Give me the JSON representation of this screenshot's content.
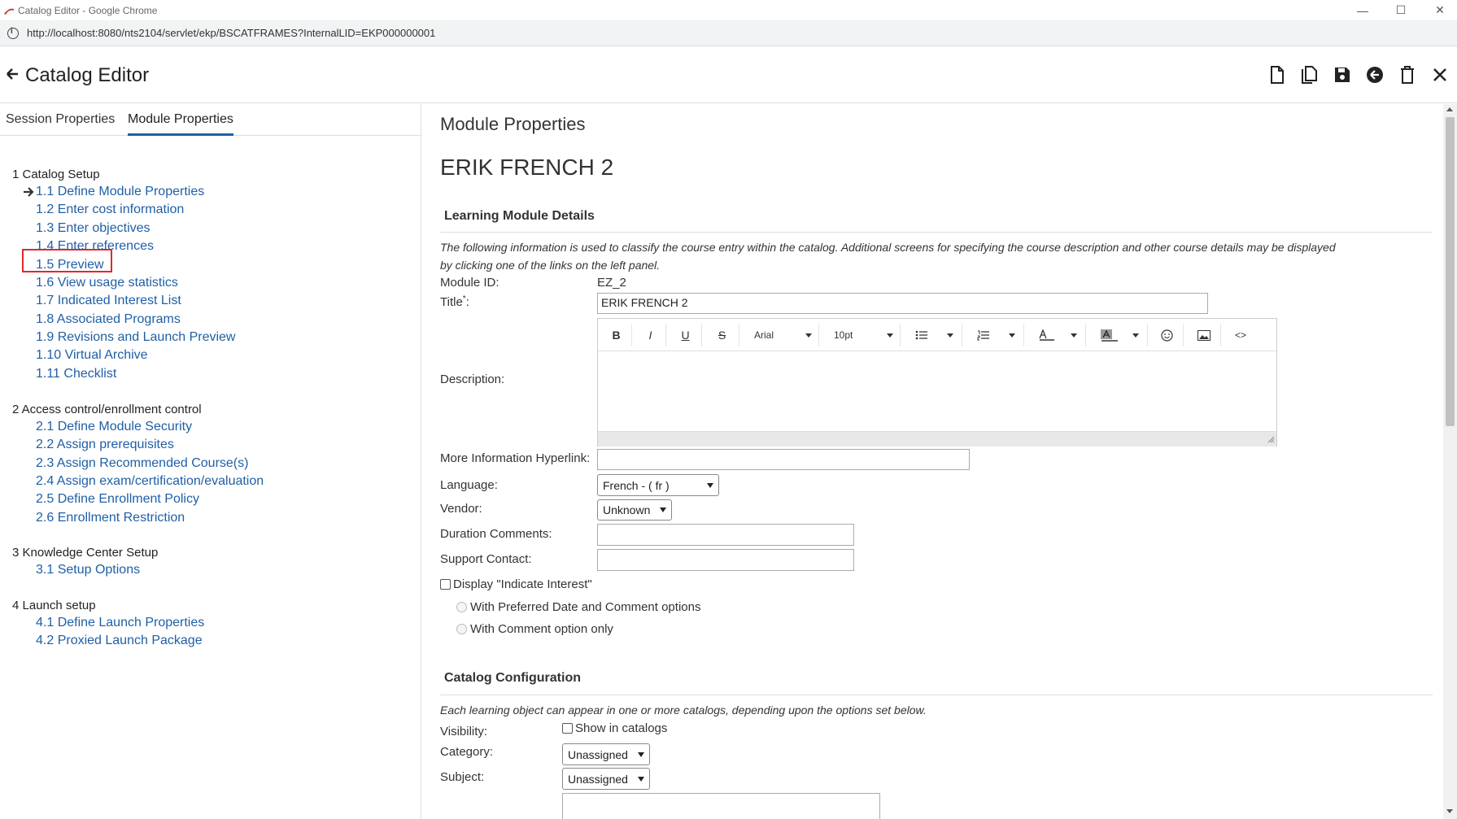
{
  "window": {
    "title": "Catalog Editor - Google Chrome",
    "url": "http://localhost:8080/nts2104/servlet/ekp/BSCATFRAMES?InternalLID=EKP000000001"
  },
  "header": {
    "title": "Catalog Editor"
  },
  "tabs": [
    {
      "label": "Session Properties"
    },
    {
      "label": "Module Properties"
    }
  ],
  "nav": {
    "sections": [
      {
        "title": "1 Catalog Setup",
        "items": [
          "1.1 Define Module Properties",
          "1.2 Enter cost information",
          "1.3 Enter objectives",
          "1.4 Enter references",
          "1.5 Preview",
          "1.6 View usage statistics",
          "1.7 Indicated Interest List",
          "1.8 Associated Programs",
          "1.9 Revisions and Launch Preview",
          "1.10 Virtual Archive",
          "1.11 Checklist"
        ]
      },
      {
        "title": "2 Access control/enrollment control",
        "items": [
          "2.1 Define Module Security",
          "2.2 Assign prerequisites",
          "2.3 Assign Recommended Course(s)",
          "2.4 Assign exam/certification/evaluation",
          "2.5 Define Enrollment Policy",
          "2.6 Enrollment Restriction"
        ]
      },
      {
        "title": "3 Knowledge Center Setup",
        "items": [
          "3.1 Setup Options"
        ]
      },
      {
        "title": "4 Launch setup",
        "items": [
          "4.1 Define Launch Properties",
          "4.2 Proxied Launch Package"
        ]
      }
    ]
  },
  "main": {
    "heading": "Module Properties",
    "module_name": "ERIK FRENCH 2",
    "details": {
      "title": "Learning Module Details",
      "description_line1": "The following information is used to classify the course entry within the catalog. Additional screens for specifying the course description and other course details may be displayed",
      "description_line2": "by clicking one of the links on the left panel.",
      "module_id_label": "Module ID:",
      "module_id": "EZ_2",
      "title_label": "Title",
      "title_required": "*",
      "title_colon": ":",
      "title_value": "ERIK FRENCH 2",
      "description_label": "Description:",
      "more_info_label": "More Information Hyperlink:",
      "language_label": "Language:",
      "language_value": "French - ( fr )",
      "vendor_label": "Vendor:",
      "vendor_value": "Unknown",
      "duration_label": "Duration Comments:",
      "support_label": "Support Contact:",
      "indicate_interest_label": "Display \"Indicate Interest\"",
      "radio1_label": "With Preferred Date and Comment options",
      "radio2_label": "With Comment option only"
    },
    "editor_toolbar": {
      "font": "Arial",
      "size": "10pt",
      "bold": "B",
      "italic": "I",
      "underline": "U",
      "strike": "S"
    },
    "catalog_config": {
      "title": "Catalog Configuration",
      "description": "Each learning object can appear in one or more catalogs, depending upon the options set below.",
      "visibility_label": "Visibility:",
      "show_in_catalogs": "Show in catalogs",
      "category_label": "Category:",
      "category_value": "Unassigned",
      "subject_label": "Subject:",
      "subject_value": "Unassigned"
    }
  },
  "colors": {
    "link": "#1f5fa6",
    "highlight": "#e0282e"
  }
}
